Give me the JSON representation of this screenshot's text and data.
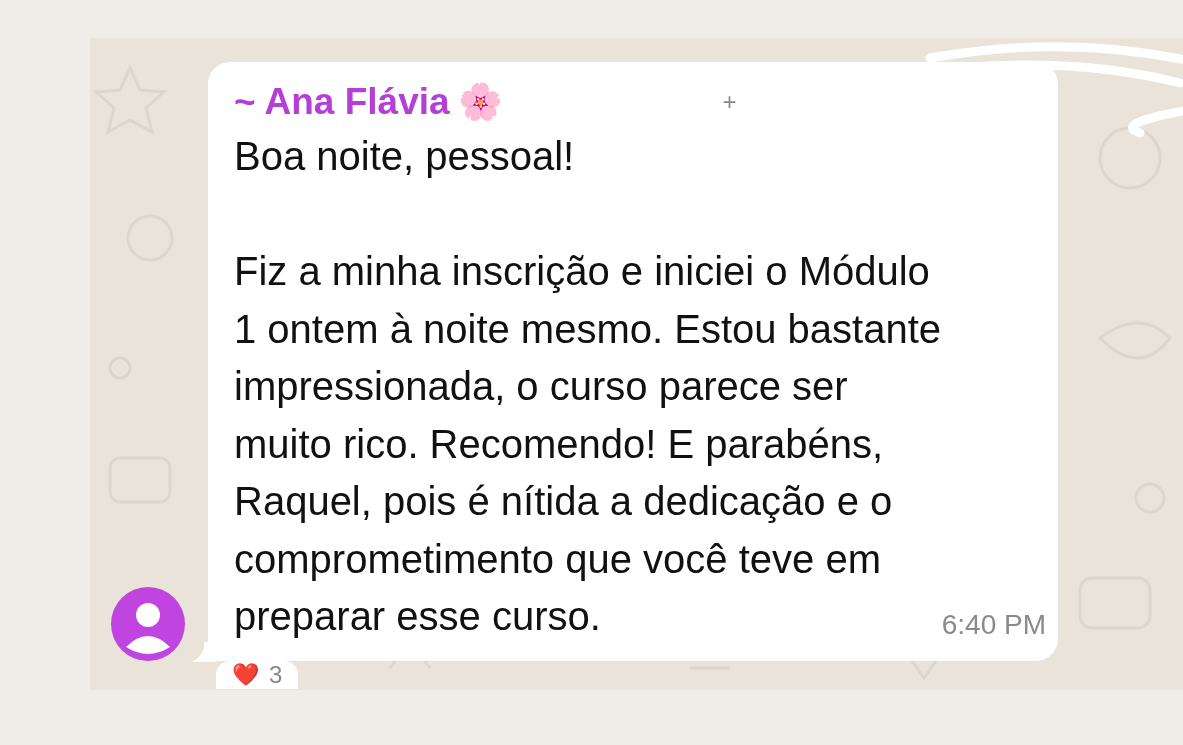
{
  "message": {
    "sender": "~ Ana Flávia",
    "sender_emoji": "🌸",
    "phone": "+",
    "paragraphs": [
      "Boa noite, pessoal!",
      "Fiz a minha inscrição e iniciei o Módulo\n1 ontem à noite mesmo. Estou bastante\nimpressionada, o curso parece ser\nmuito rico. Recomendo! E parabéns,\nRaquel, pois é nítida a dedicação e o\ncomprometimento que você teve em\npreparar esse curso."
    ],
    "time": "6:40 PM",
    "reaction": {
      "emoji": "❤️",
      "count": "3"
    }
  }
}
